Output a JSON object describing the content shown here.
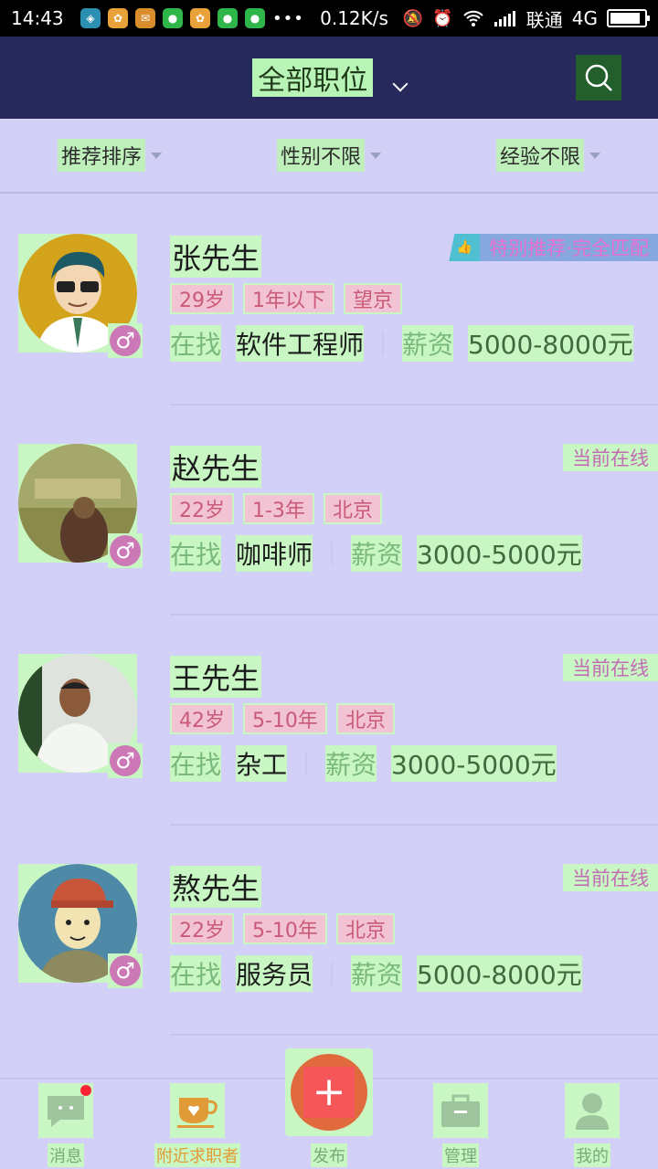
{
  "status_bar": {
    "time": "14:43",
    "speed": "0.12K/s",
    "carrier": "联通",
    "network": "4G"
  },
  "header": {
    "title": "全部职位",
    "search_icon": "search-icon"
  },
  "filters": [
    {
      "label": "推荐排序"
    },
    {
      "label": "性别不限"
    },
    {
      "label": "经验不限"
    }
  ],
  "candidates": [
    {
      "name": "张先生",
      "age": "29岁",
      "experience": "1年以下",
      "location": "望京",
      "seeking_label": "在找",
      "job": "软件工程师",
      "salary_label": "薪资",
      "salary": "5000-8000元",
      "badge": "特别推荐·完全匹配"
    },
    {
      "name": "赵先生",
      "age": "22岁",
      "experience": "1-3年",
      "location": "北京",
      "seeking_label": "在找",
      "job": "咖啡师",
      "salary_label": "薪资",
      "salary": "3000-5000元",
      "badge": "当前在线"
    },
    {
      "name": "王先生",
      "age": "42岁",
      "experience": "5-10年",
      "location": "北京",
      "seeking_label": "在找",
      "job": "杂工",
      "salary_label": "薪资",
      "salary": "3000-5000元",
      "badge": "当前在线"
    },
    {
      "name": "熬先生",
      "age": "22岁",
      "experience": "5-10年",
      "location": "北京",
      "seeking_label": "在找",
      "job": "服务员",
      "salary_label": "薪资",
      "salary": "5000-8000元",
      "badge": "当前在线"
    }
  ],
  "bottom_nav": [
    {
      "label": "消息",
      "icon": "chat-icon"
    },
    {
      "label": "附近求职者",
      "icon": "coffee-cup-icon"
    },
    {
      "label": "发布",
      "icon": "plus-icon"
    },
    {
      "label": "管理",
      "icon": "briefcase-icon"
    },
    {
      "label": "我的",
      "icon": "person-icon"
    }
  ],
  "colors": {
    "header_bg": "#27295a",
    "page_bg": "#d3d0f8",
    "accent_orange": "#e39a35",
    "fab": "#e06a3d"
  }
}
